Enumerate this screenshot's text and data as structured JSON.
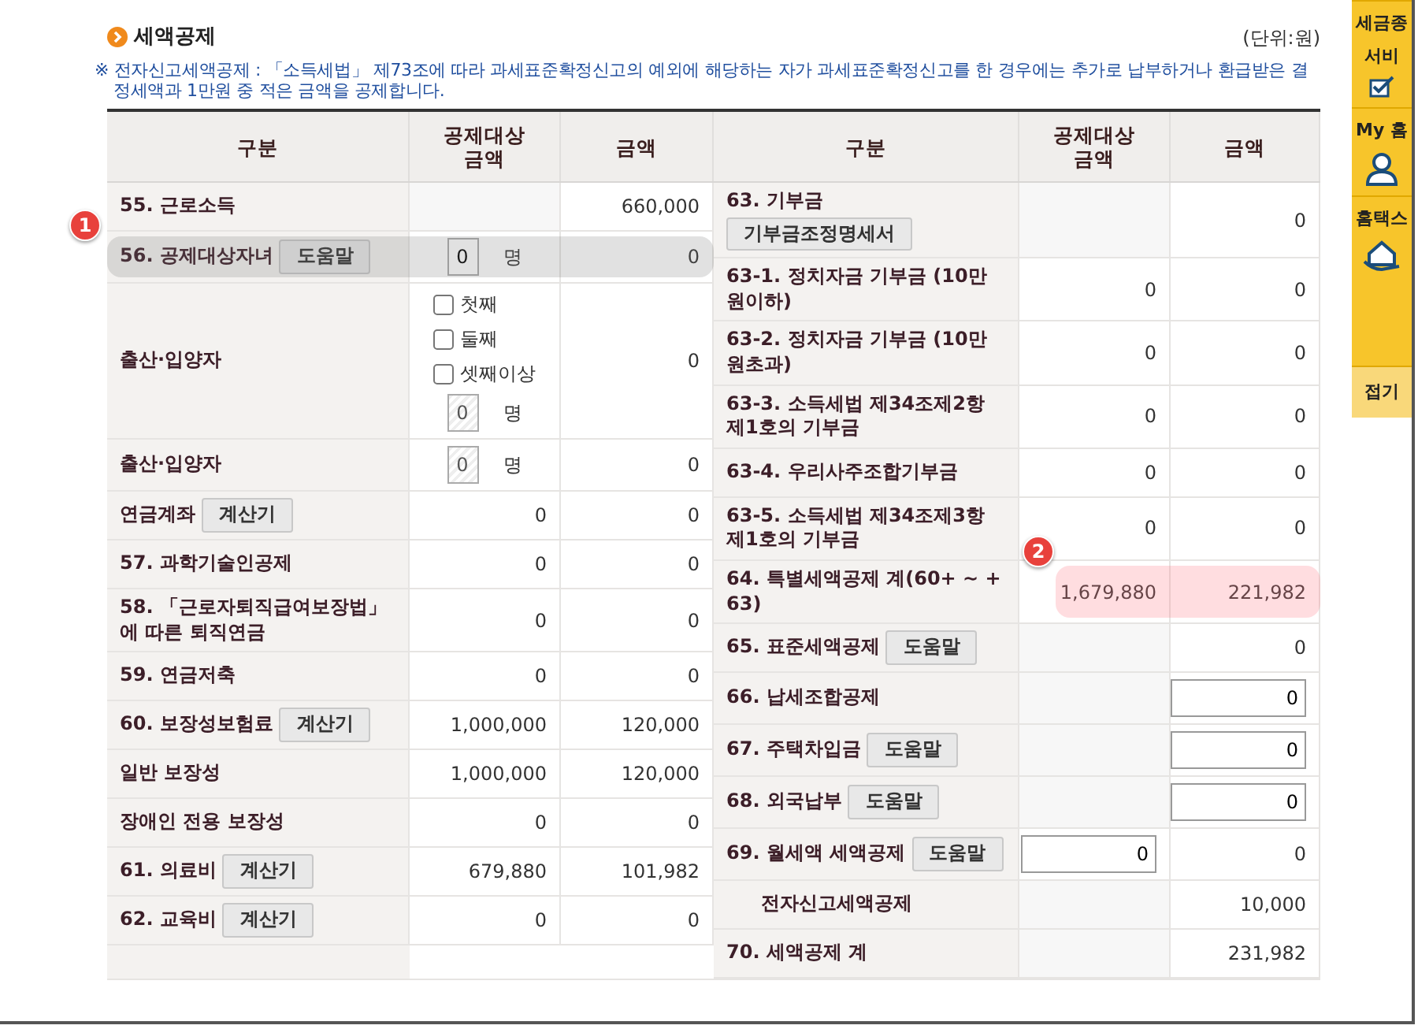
{
  "section": {
    "title": "세액공제",
    "unit": "(단위:원)",
    "note": "※ 전자신고세액공제 : 「소득세법」 제73조에 따라 과세표준확정신고의 예외에 해당하는 자가 과세표준확정신고를 한 경우에는 추가로 납부하거나 환급받은 결정세액과 1만원 중 적은 금액을 공제합니다."
  },
  "columns": [
    "구분",
    "공제대상금액",
    "금액",
    "구분",
    "공제대상금액",
    "금액"
  ],
  "left_rows": [
    {
      "label": "55. 근로소득",
      "amount": {
        "kind": "text",
        "value": "660,000"
      }
    },
    {
      "label": "56. 공제대상자녀",
      "button": "도움말",
      "target": {
        "kind": "count",
        "value": "0",
        "unit": "명",
        "disabled": false
      },
      "amount": {
        "kind": "text",
        "value": "0"
      },
      "callout": {
        "number": "1"
      }
    },
    {
      "label": "출산·입양자",
      "target": {
        "kind": "checkboxes",
        "options": [
          {
            "label": "첫째",
            "checked": false
          },
          {
            "label": "둘째",
            "checked": false
          },
          {
            "label": "셋째이상",
            "checked": false
          }
        ],
        "value": "0",
        "unit": "명",
        "disabled": true
      },
      "amount": {
        "kind": "text",
        "value": "0"
      }
    },
    {
      "label": "출산·입양자",
      "target": {
        "kind": "count",
        "value": "0",
        "unit": "명",
        "disabled": true
      },
      "amount": {
        "kind": "text",
        "value": "0"
      }
    },
    {
      "label": "연금계좌",
      "button": "계산기",
      "target": {
        "kind": "text",
        "value": "0"
      },
      "amount": {
        "kind": "text",
        "value": "0"
      }
    },
    {
      "label": "57. 과학기술인공제",
      "target": {
        "kind": "text",
        "value": "0"
      },
      "amount": {
        "kind": "text",
        "value": "0"
      }
    },
    {
      "label": "58. 「근로자퇴직급여보장법」에 따른 퇴직연금",
      "target": {
        "kind": "text",
        "value": "0"
      },
      "amount": {
        "kind": "text",
        "value": "0"
      }
    },
    {
      "label": "59. 연금저축",
      "target": {
        "kind": "text",
        "value": "0"
      },
      "amount": {
        "kind": "text",
        "value": "0"
      }
    },
    {
      "label": "60. 보장성보험료",
      "button": "계산기",
      "target": {
        "kind": "text",
        "value": "1,000,000"
      },
      "amount": {
        "kind": "text",
        "value": "120,000"
      }
    },
    {
      "label": "일반 보장성",
      "target": {
        "kind": "text",
        "value": "1,000,000"
      },
      "amount": {
        "kind": "text",
        "value": "120,000"
      }
    },
    {
      "label": "장애인 전용 보장성",
      "target": {
        "kind": "text",
        "value": "0"
      },
      "amount": {
        "kind": "text",
        "value": "0"
      }
    },
    {
      "label": "61. 의료비",
      "button": "계산기",
      "target": {
        "kind": "text",
        "value": "679,880"
      },
      "amount": {
        "kind": "text",
        "value": "101,982"
      }
    },
    {
      "label": "62. 교육비",
      "button": "계산기",
      "target": {
        "kind": "text",
        "value": "0"
      },
      "amount": {
        "kind": "text",
        "value": "0"
      }
    }
  ],
  "right_rows": [
    {
      "label": "63. 기부금",
      "button": "기부금조정명세서",
      "amount": {
        "kind": "text",
        "value": "0"
      }
    },
    {
      "label": "63-1. 정치자금 기부금 (10만원이하)",
      "target": {
        "kind": "text",
        "value": "0"
      },
      "amount": {
        "kind": "text",
        "value": "0"
      }
    },
    {
      "label": "63-2. 정치자금 기부금 (10만원초과)",
      "target": {
        "kind": "text",
        "value": "0"
      },
      "amount": {
        "kind": "text",
        "value": "0"
      }
    },
    {
      "label": "63-3. 소득세법 제34조제2항 제1호의 기부금",
      "target": {
        "kind": "text",
        "value": "0"
      },
      "amount": {
        "kind": "text",
        "value": "0"
      }
    },
    {
      "label": "63-4. 우리사주조합기부금",
      "target": {
        "kind": "text",
        "value": "0"
      },
      "amount": {
        "kind": "text",
        "value": "0"
      }
    },
    {
      "label": "63-5. 소득세법 제34조제3항 제1호의 기부금",
      "target": {
        "kind": "text",
        "value": "0"
      },
      "amount": {
        "kind": "text",
        "value": "0"
      }
    },
    {
      "label": "64. 특별세액공제 계(60+ ~ + 63)",
      "target": {
        "kind": "text",
        "value": "1,679,880"
      },
      "amount": {
        "kind": "text",
        "value": "221,982"
      },
      "callout": {
        "number": "2"
      }
    },
    {
      "label": "65. 표준세액공제",
      "button": "도움말",
      "amount": {
        "kind": "text",
        "value": "0"
      }
    },
    {
      "label": "66. 납세조합공제",
      "amount": {
        "kind": "input",
        "value": "0"
      }
    },
    {
      "label": "67. 주택차입금",
      "button": "도움말",
      "amount": {
        "kind": "input",
        "value": "0"
      }
    },
    {
      "label": "68. 외국납부",
      "button": "도움말",
      "amount": {
        "kind": "input",
        "value": "0"
      }
    },
    {
      "label": "69. 월세액 세액공제",
      "button": "도움말",
      "target": {
        "kind": "input",
        "value": "0"
      },
      "amount": {
        "kind": "text",
        "value": "0"
      }
    },
    {
      "label": "전자신고세액공제",
      "indent": true,
      "amount": {
        "kind": "text",
        "value": "10,000"
      }
    },
    {
      "label": "70. 세액공제 계",
      "amount": {
        "kind": "text",
        "value": "231,982"
      }
    }
  ],
  "side_panel": [
    {
      "lines": [
        "세금종",
        "서비"
      ],
      "kind": "menu"
    },
    {
      "lines": [
        "My 홈"
      ],
      "kind": "menu"
    },
    {
      "lines": [
        "홈택스"
      ],
      "kind": "menu"
    },
    {
      "lines": [
        "접기"
      ],
      "kind": "fold"
    }
  ]
}
